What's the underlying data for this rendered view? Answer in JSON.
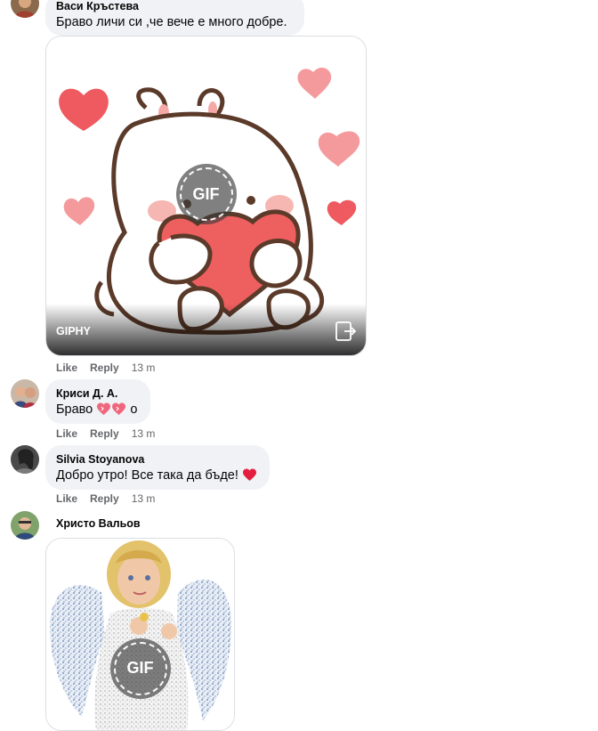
{
  "comments": [
    {
      "author": "Васи Кръстева",
      "text": "Браво личи си ,че вече е много добре."
    },
    {
      "gif_badge": "GIF",
      "gif_provider": "GIPHY",
      "like": "Like",
      "reply": "Reply",
      "time": "13 m"
    },
    {
      "author": "Криси Д. А.",
      "text_before": "Браво",
      "text_after": "о",
      "like": "Like",
      "reply": "Reply",
      "time": "13 m"
    },
    {
      "author": "Silvia Stoyanova",
      "text": "Добро утро! Все така да бъде!",
      "like": "Like",
      "reply": "Reply",
      "time": "13 m"
    },
    {
      "author": "Христо Вальов",
      "gif_badge": "GIF"
    }
  ],
  "colors": {
    "bubble": "#f0f2f5",
    "meta_text": "#65676b",
    "heart": "#ee5a5f",
    "emoji_heart": "#e41e3f"
  },
  "icons": [
    "avatar",
    "heart-emoji",
    "hearts-emoji",
    "open-link-icon",
    "gif-play-badge"
  ]
}
